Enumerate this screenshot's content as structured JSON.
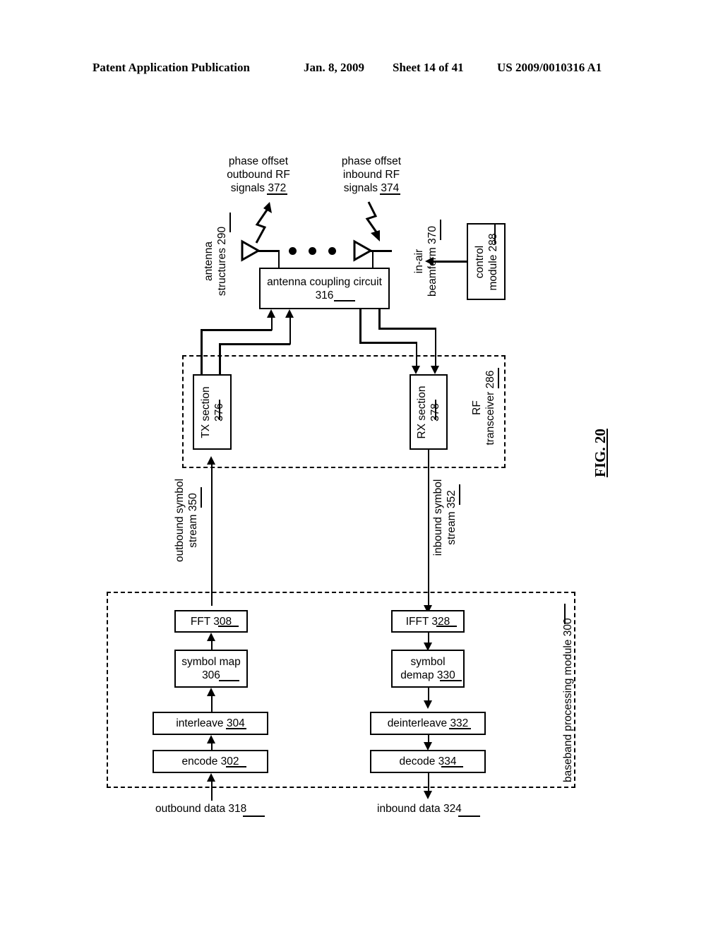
{
  "header": {
    "publication": "Patent Application Publication",
    "date": "Jan. 8, 2009",
    "sheet": "Sheet 14 of 41",
    "number": "US 2009/0010316 A1"
  },
  "figure": {
    "label": "FIG. 20"
  },
  "annotations": {
    "phase_offset_outbound": "phase offset\noutbound RF\nsignals 372",
    "phase_offset_outbound_ref": "372",
    "phase_offset_inbound": "phase offset\ninbound RF\nsignals 374",
    "phase_offset_inbound_ref": "374",
    "antenna_structures": "antenna\nstructures 290",
    "antenna_structures_ref": "290",
    "in_air_beamform": "in-air\nbeamform 370",
    "in_air_beamform_ref": "370",
    "outbound_symbol_stream": "outbound symbol\nstream 350",
    "outbound_symbol_stream_ref": "350",
    "inbound_symbol_stream": "inbound symbol\nstream 352",
    "inbound_symbol_stream_ref": "352",
    "outbound_data": "outbound data 318",
    "outbound_data_ref": "318",
    "inbound_data": "inbound data 324",
    "inbound_data_ref": "324"
  },
  "blocks": {
    "antenna_coupling_circuit": "antenna coupling\ncircuit 316",
    "antenna_coupling_circuit_ref": "316",
    "control_module": "control\nmodule 288",
    "control_module_ref": "288",
    "tx_section": "TX section\n376",
    "tx_section_ref": "376",
    "rx_section": "RX section\n378",
    "rx_section_ref": "378",
    "fft": "FFT 308",
    "fft_ref": "308",
    "symbol_map": "symbol\nmap 306",
    "symbol_map_ref": "306",
    "interleave": "interleave 304",
    "interleave_ref": "304",
    "encode": "encode 302",
    "encode_ref": "302",
    "ifft": "IFFT 328",
    "ifft_ref": "328",
    "symbol_demap": "symbol\ndemap 330",
    "symbol_demap_ref": "330",
    "deinterleave": "deinterleave 332",
    "deinterleave_ref": "332",
    "decode": "decode 334",
    "decode_ref": "334"
  },
  "containers": {
    "rf_transceiver": "RF\ntransceiver 286",
    "rf_transceiver_ref": "286",
    "baseband_processing_module": "baseband processing module 300",
    "baseband_processing_module_ref": "300"
  },
  "colors": {
    "ink": "#000000",
    "paper": "#ffffff"
  }
}
